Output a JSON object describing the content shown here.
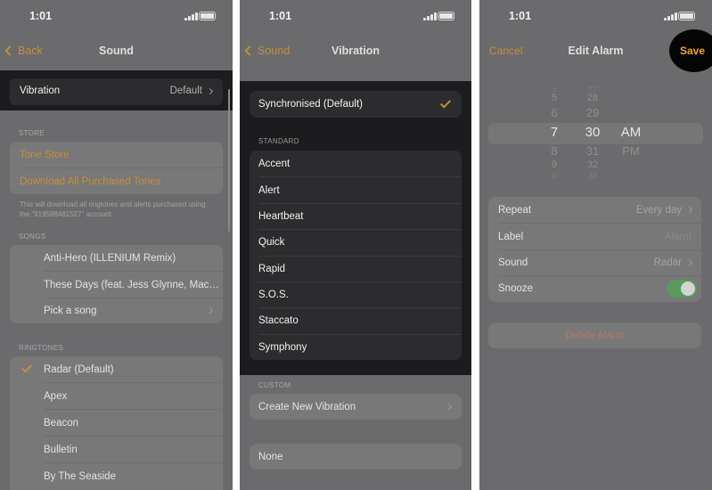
{
  "status_time": "1:01",
  "panel1": {
    "nav": {
      "back_label": "Back",
      "title": "Sound"
    },
    "vibration": {
      "label": "Vibration",
      "value": "Default"
    },
    "store": {
      "header": "STORE",
      "tone_store": "Tone Store",
      "download_all": "Download All Purchased Tones",
      "note": "This will download all ringtones and alerts purchased using the \"919588481527\" account."
    },
    "songs": {
      "header": "SONGS",
      "items": [
        "Anti-Hero (ILLENIUM Remix)",
        "These Days (feat. Jess Glynne, Mac…",
        "Pick a song"
      ]
    },
    "ringtones": {
      "header": "RINGTONES",
      "items": [
        "Radar (Default)",
        "Apex",
        "Beacon",
        "Bulletin",
        "By The Seaside"
      ],
      "selected": "Radar (Default)"
    }
  },
  "panel2": {
    "nav": {
      "back_label": "Sound",
      "title": "Vibration"
    },
    "synchronised": "Synchronised (Default)",
    "standard": {
      "header": "STANDARD",
      "items": [
        "Accent",
        "Alert",
        "Heartbeat",
        "Quick",
        "Rapid",
        "S.O.S.",
        "Staccato",
        "Symphony"
      ]
    },
    "custom": {
      "header": "CUSTOM",
      "create": "Create New Vibration"
    },
    "none": "None"
  },
  "panel3": {
    "nav": {
      "cancel": "Cancel",
      "title": "Edit Alarm",
      "save": "Save"
    },
    "picker": {
      "hours": [
        "4",
        "5",
        "6",
        "7",
        "8",
        "9",
        "10"
      ],
      "minutes": [
        "27",
        "28",
        "29",
        "30",
        "31",
        "32",
        "33"
      ],
      "period": [
        "AM",
        "PM"
      ],
      "selected_hour": "7",
      "selected_minute": "30",
      "selected_period": "AM"
    },
    "settings": {
      "repeat": {
        "label": "Repeat",
        "value": "Every day"
      },
      "label": {
        "label": "Label",
        "value": "Alarm"
      },
      "sound": {
        "label": "Sound",
        "value": "Radar"
      },
      "snooze": {
        "label": "Snooze",
        "on": true
      }
    },
    "delete": "Delete Alarm"
  },
  "colors": {
    "accent": "#c48f3c",
    "save": "#f0a733",
    "dim_bg": "#6b6b6d",
    "dark": "#1c1c1e",
    "toggle_on": "#5a9a5e"
  }
}
